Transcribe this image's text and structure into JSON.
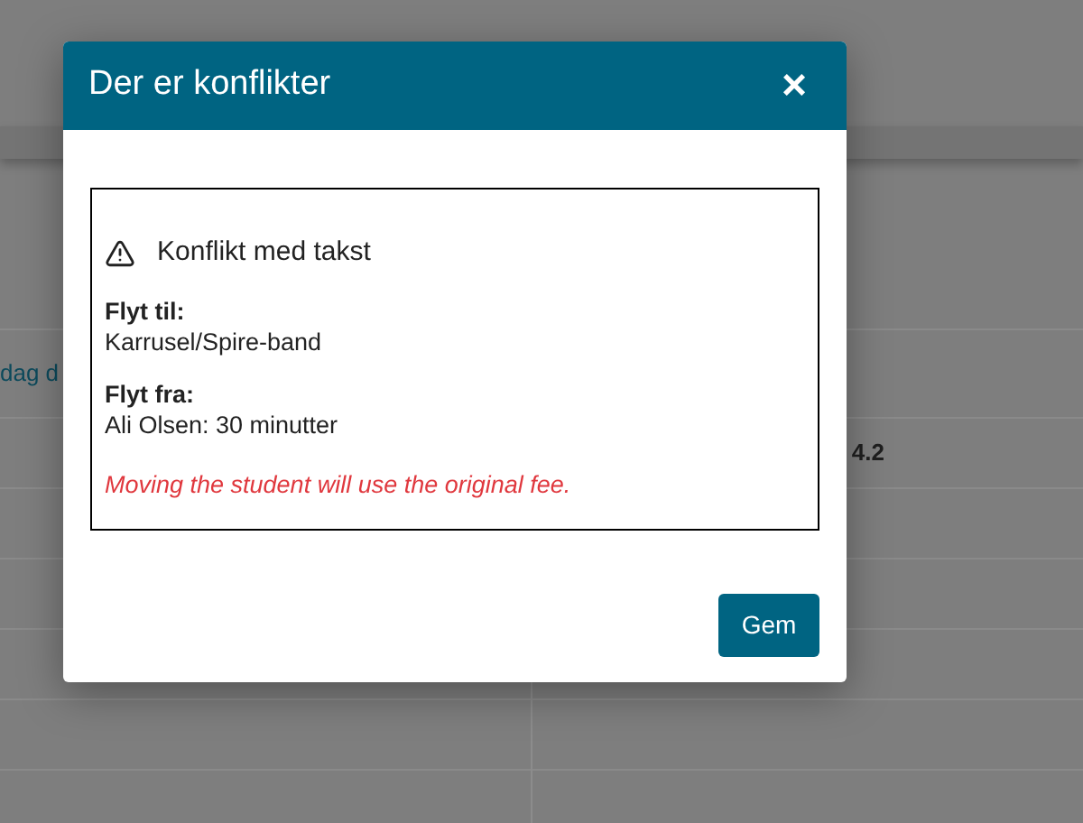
{
  "background": {
    "link_text": "dag d",
    "value_text": "4.2"
  },
  "dialog": {
    "title": "Der er konflikter",
    "close_label": "×",
    "conflict": {
      "heading": "Konflikt med takst",
      "sections": [
        {
          "label": "Flyt til:",
          "value": "Karrusel/Spire-band"
        },
        {
          "label": "Flyt fra:",
          "value": "Ali Olsen: 30 minutter"
        }
      ],
      "warning": "Moving the student will use the original fee."
    },
    "buttons": [
      "Gem"
    ]
  }
}
